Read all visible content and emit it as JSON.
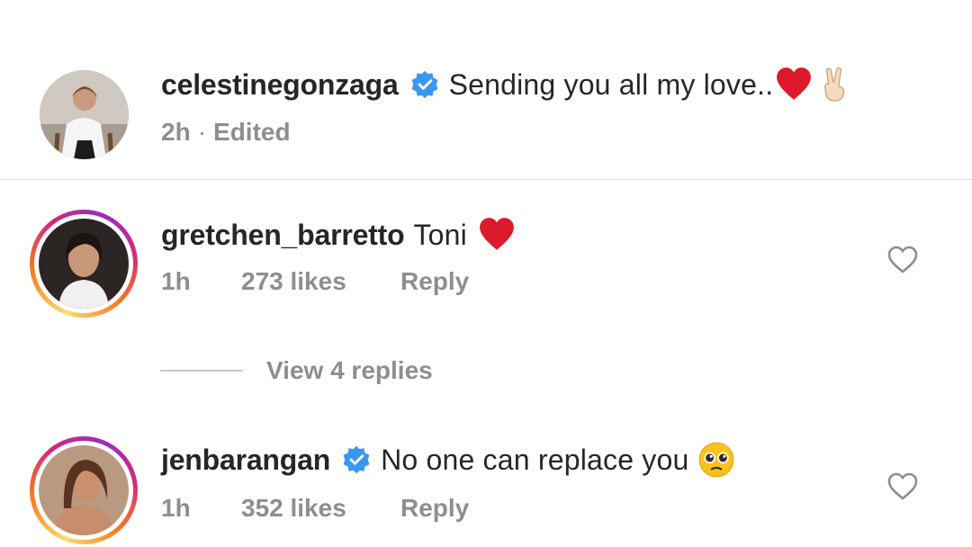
{
  "caption": {
    "username": "celestinegonzaga",
    "text": "Sending you all my love..",
    "emojis": [
      "heart-emoji",
      "victory-hand-emoji"
    ],
    "time": "2h",
    "separator": "·",
    "edited": "Edited"
  },
  "comments": [
    {
      "username": "gretchen_barretto",
      "verified": false,
      "text": "Toni",
      "emoji": "heart-emoji",
      "time": "1h",
      "likes": "273 likes",
      "reply_label": "Reply",
      "view_replies": "View 4 replies"
    },
    {
      "username": "jenbarangan",
      "verified": true,
      "text": "No one can replace you",
      "emoji": "pleading-face-emoji",
      "time": "1h",
      "likes": "352 likes",
      "reply_label": "Reply"
    }
  ],
  "colors": {
    "verified_blue": "#3897f0",
    "meta_gray": "#8e8e8e",
    "text": "#262626",
    "heart_red": "#e0245e"
  }
}
